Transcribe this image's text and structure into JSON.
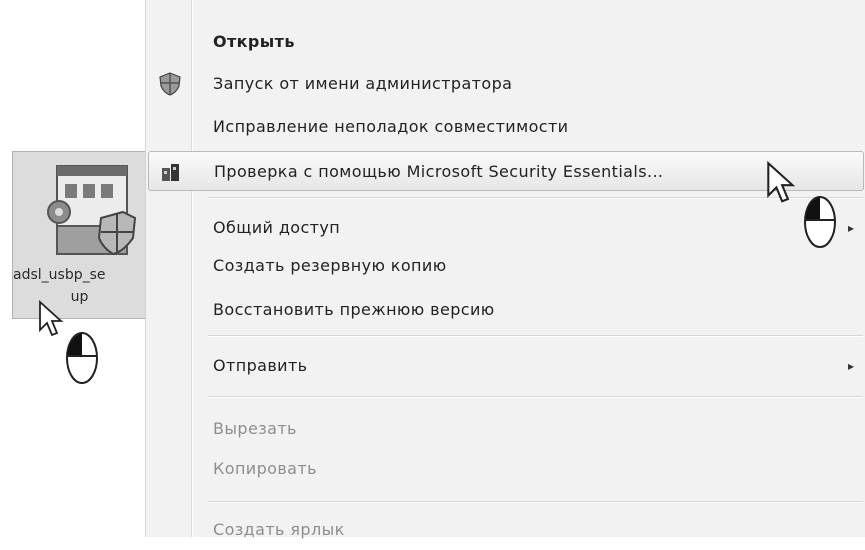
{
  "file": {
    "name_line1": "adsl_usbp_se",
    "name_line2": "up",
    "icon": "setup-program-icon"
  },
  "menu": {
    "items": [
      {
        "label": "Открыть",
        "bold": true
      },
      {
        "label": "Запуск от имени администратора",
        "icon": "shield-icon"
      },
      {
        "label": "Исправление неполадок совместимости"
      },
      {
        "label": "Проверка с помощью Microsoft Security Essentials...",
        "icon": "security-essentials-icon",
        "highlighted": true
      },
      {
        "label": "Общий доступ",
        "submenu": true
      },
      {
        "label": "Создать резервную копию"
      },
      {
        "label": "Восстановить прежнюю версию"
      },
      {
        "label": "Отправить",
        "submenu": true
      },
      {
        "label": "Вырезать",
        "disabled": true
      },
      {
        "label": "Копировать",
        "disabled": true
      },
      {
        "label": "Создать ярлык",
        "disabled": true
      }
    ],
    "submenu_arrow": "▸"
  },
  "cursors": [
    "arrow-cursor",
    "mouse-left-click-icon"
  ]
}
